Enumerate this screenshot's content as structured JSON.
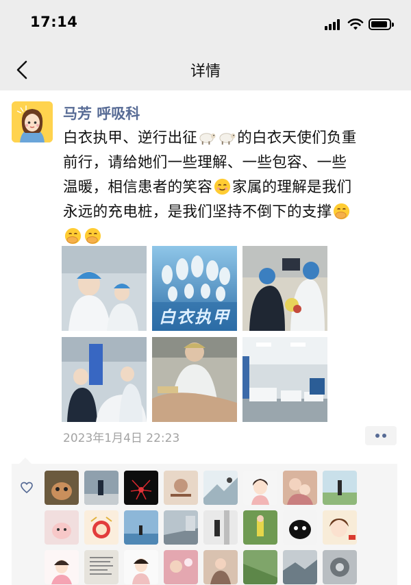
{
  "status_bar": {
    "time": "17:14"
  },
  "nav": {
    "title": "详情",
    "back_icon": "chevron-left-icon"
  },
  "post": {
    "author": "马芳 呼吸科",
    "lines": [
      "白衣执甲、逆行出征",
      "的白衣天使们负重",
      "前行，请给她们一些理解、一些包容、一些",
      "温暖，相信患者的笑容",
      "家属的理解是我们",
      "永远的充电桩，是我们坚持不倒下的支撑"
    ],
    "emoji": [
      "sheep",
      "smiling-face",
      "face-with-hand-over-mouth"
    ],
    "photo_overlay_text": "白衣执甲",
    "photos_count": 6,
    "timestamp": "2023年1月4日 22:23"
  },
  "likes": {
    "icon": "heart-outline-icon",
    "count": 24
  },
  "colors": {
    "link_blue": "#576b95",
    "header_bg": "#ededed",
    "likes_bg": "#f5f5f5",
    "timestamp_gray": "#a3a3a3"
  }
}
